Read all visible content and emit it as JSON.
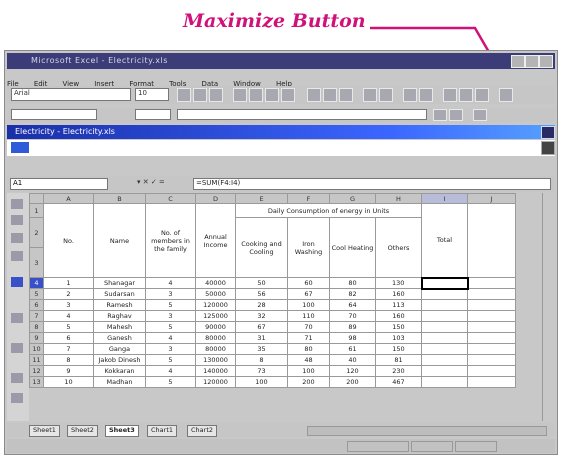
{
  "annotation": {
    "label": "Maximize Button",
    "color": "#d0117a"
  },
  "excel": {
    "title": "Microsoft Excel - Electricity.xls",
    "menu": [
      "File",
      "Edit",
      "View",
      "Insert",
      "Format",
      "Tools",
      "Data",
      "Window",
      "Help"
    ],
    "font_name": "Arial",
    "font_size": "10",
    "child_title": "Electricity - Electricity.xls",
    "namebox": "A1",
    "formula": "=SUM(F4:I4)",
    "columns": [
      "A",
      "B",
      "C",
      "D",
      "E",
      "F",
      "G",
      "H",
      "I",
      "J"
    ],
    "header": {
      "no": "No.",
      "name": "Name",
      "members": "No. of members in the family",
      "income": "Annual Income",
      "daily": "Daily Consumption of energy in Units",
      "sub": [
        "Cooking and Cooling",
        "Iron Washing",
        "Cool Heating",
        "Others"
      ],
      "total": "Total"
    },
    "header_rows": [
      "1",
      "2",
      "3"
    ],
    "rows": [
      {
        "rh": "4",
        "no": "1",
        "name": "Shanagar",
        "members": "4",
        "income": "40000",
        "a": "50",
        "b": "60",
        "c": "80",
        "d": "130"
      },
      {
        "rh": "5",
        "no": "2",
        "name": "Sudarsan",
        "members": "3",
        "income": "50000",
        "a": "56",
        "b": "67",
        "c": "82",
        "d": "160"
      },
      {
        "rh": "6",
        "no": "3",
        "name": "Ramesh",
        "members": "5",
        "income": "120000",
        "a": "28",
        "b": "100",
        "c": "64",
        "d": "113"
      },
      {
        "rh": "7",
        "no": "4",
        "name": "Raghav",
        "members": "3",
        "income": "125000",
        "a": "32",
        "b": "110",
        "c": "70",
        "d": "160"
      },
      {
        "rh": "8",
        "no": "5",
        "name": "Mahesh",
        "members": "5",
        "income": "90000",
        "a": "67",
        "b": "70",
        "c": "89",
        "d": "150"
      },
      {
        "rh": "9",
        "no": "6",
        "name": "Ganesh",
        "members": "4",
        "income": "80000",
        "a": "31",
        "b": "71",
        "c": "98",
        "d": "103"
      },
      {
        "rh": "10",
        "no": "7",
        "name": "Ganga",
        "members": "3",
        "income": "80000",
        "a": "35",
        "b": "80",
        "c": "61",
        "d": "150"
      },
      {
        "rh": "11",
        "no": "8",
        "name": "Jakob Dinesh",
        "members": "5",
        "income": "130000",
        "a": "8",
        "b": "48",
        "c": "40",
        "d": "81"
      },
      {
        "rh": "12",
        "no": "9",
        "name": "Kokkaran",
        "members": "4",
        "income": "140000",
        "a": "73",
        "b": "100",
        "c": "120",
        "d": "230"
      },
      {
        "rh": "13",
        "no": "10",
        "name": "Madhan",
        "members": "5",
        "income": "120000",
        "a": "100",
        "b": "200",
        "c": "200",
        "d": "467"
      }
    ],
    "sheet_tabs": [
      "Sheet1",
      "Sheet2",
      "Sheet3",
      "Chart1",
      "Chart2"
    ]
  }
}
